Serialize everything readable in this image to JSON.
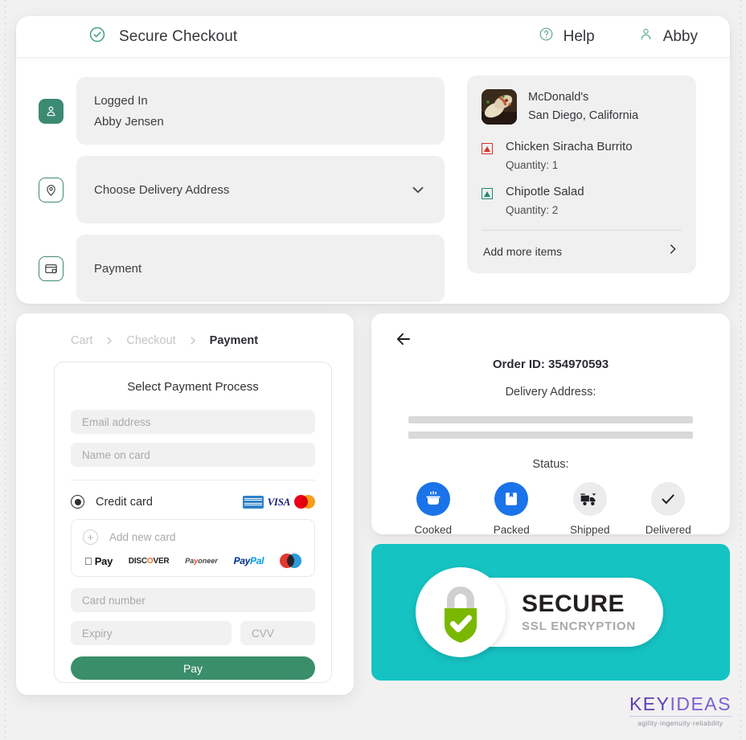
{
  "header": {
    "title": "Secure Checkout",
    "secure_icon": "check-circle-icon",
    "help_label": "Help",
    "help_icon": "question-circle-icon",
    "account_label": "Abby",
    "account_icon": "user-icon"
  },
  "steps": [
    {
      "icon": "user-filled-icon",
      "label": "Logged In",
      "value": "Abby Jensen"
    },
    {
      "icon": "location-pin-icon",
      "label": "Choose Delivery Address",
      "chevron": "chevron-down-icon"
    },
    {
      "icon": "credit-card-shield-icon",
      "label": "Payment"
    }
  ],
  "order_summary": {
    "restaurant_name": "McDonald's",
    "restaurant_location": "San Diego, California",
    "thumbnail": "burrito-photo",
    "items": [
      {
        "name": "Chicken Siracha Burrito",
        "quantity_label": "Quantity: 1",
        "diet": "non-veg"
      },
      {
        "name": "Chipotle Salad",
        "quantity_label": "Quantity: 2",
        "diet": "veg"
      }
    ],
    "add_more_label": "Add more items",
    "add_more_icon": "chevron-right-icon"
  },
  "breadcrumb": {
    "items": [
      "Cart",
      "Checkout",
      "Payment"
    ],
    "active_index": 2,
    "separator_icon": "chevron-right-icon"
  },
  "payment_form": {
    "title": "Select Payment Process",
    "email_placeholder": "Email address",
    "name_placeholder": "Name on card",
    "credit_card_label": "Credit card",
    "credit_card_selected": true,
    "accepted_cards": [
      "American Express",
      "VISA",
      "Mastercard"
    ],
    "add_new_card_label": "Add new card",
    "add_new_card_icon": "plus-circle-icon",
    "wallets": [
      "Apple Pay",
      "DISCOVER",
      "Payoneer",
      "PayPal",
      "maestro"
    ],
    "card_number_placeholder": "Card number",
    "expiry_placeholder": "Expiry",
    "cvv_placeholder": "CVV",
    "pay_button_label": "Pay",
    "pay_button_color": "#3a8e6a"
  },
  "order_status": {
    "back_icon": "arrow-left-icon",
    "order_id": "Order ID: 354970593",
    "delivery_address_label": "Delivery Address:",
    "status_label": "Status:",
    "active_color": "#1a73e8",
    "inactive_color": "#ececec",
    "steps": [
      {
        "label": "Cooked",
        "icon": "cooking-pot-icon",
        "active": true
      },
      {
        "label": "Packed",
        "icon": "package-box-icon",
        "active": true
      },
      {
        "label": "Shipped",
        "icon": "delivery-truck-icon",
        "active": false
      },
      {
        "label": "Delivered",
        "icon": "check-icon",
        "active": false
      }
    ]
  },
  "ssl_banner": {
    "headline": "SECURE",
    "subline": "SSL ENCRYPTION",
    "icon": "padlock-check-icon",
    "background_color": "#15c3c3",
    "lock_color": "#7ab800"
  },
  "brand": {
    "name_key": "KEY",
    "name_ideas": "IDEAS",
    "tagline": "agility·ingenuity·reliability"
  }
}
